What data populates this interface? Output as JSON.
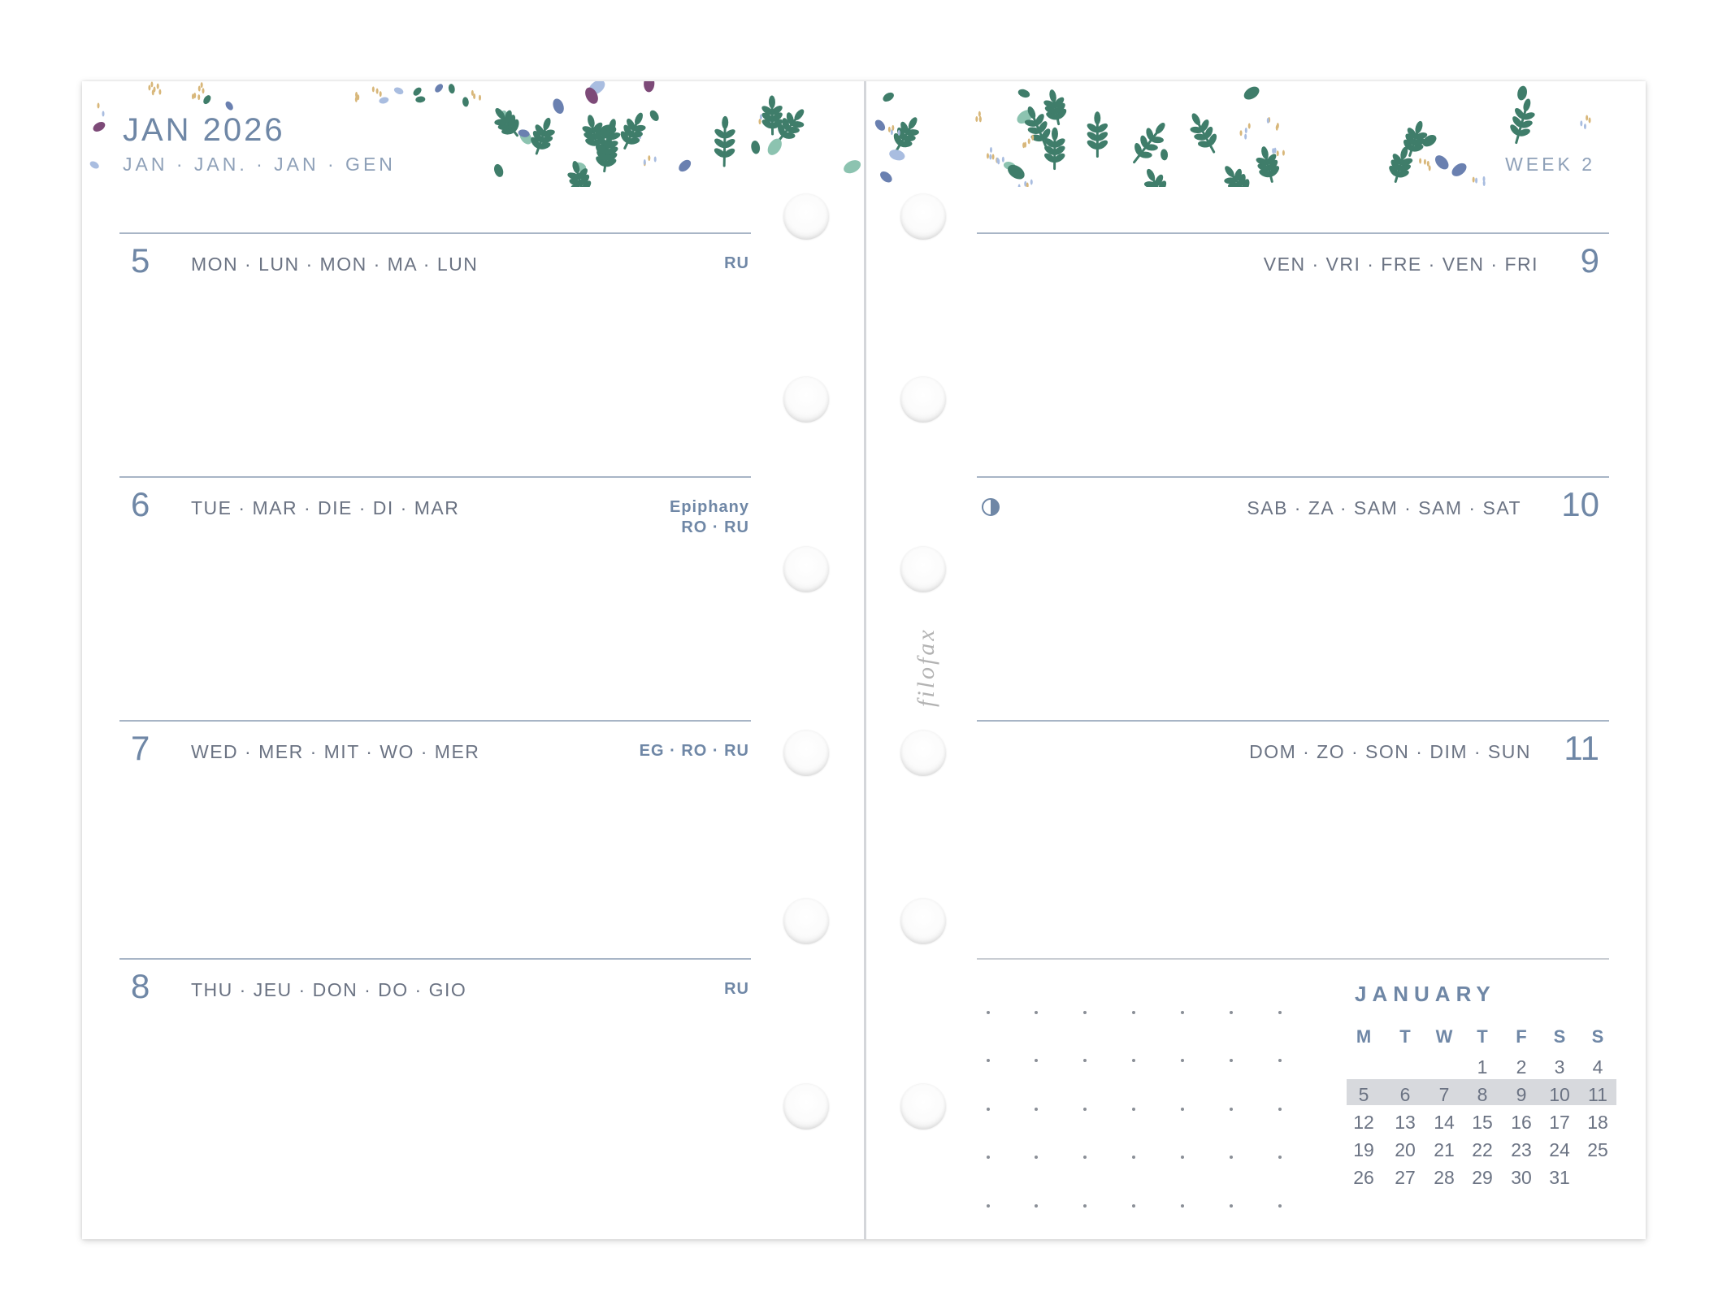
{
  "page": {
    "month_title": "JAN 2026",
    "month_sub": "JAN · JAN. · JAN · GEN",
    "week_label": "WEEK 2",
    "brand": "filofax"
  },
  "days": {
    "d5": {
      "num": "5",
      "names": "MON · LUN · MON · MA · LUN",
      "holiday1": "RU",
      "holiday2": ""
    },
    "d6": {
      "num": "6",
      "names": "TUE · MAR · DIE · DI · MAR",
      "holiday1": "Epiphany",
      "holiday2": "RO · RU"
    },
    "d7": {
      "num": "7",
      "names": "WED · MER · MIT · WO · MER",
      "holiday1": "EG · RO · RU",
      "holiday2": ""
    },
    "d8": {
      "num": "8",
      "names": "THU · JEU · DON · DO · GIO",
      "holiday1": "RU",
      "holiday2": ""
    },
    "d9": {
      "num": "9",
      "names": "VEN · VRI · FRE · VEN · FRI"
    },
    "d10": {
      "num": "10",
      "names": "SAB · ZA · SAM · SAM · SAT",
      "moon_icon": "first-quarter-moon-icon"
    },
    "d11": {
      "num": "11",
      "names": "DOM · ZO · SON · DIM · SUN"
    }
  },
  "mini_calendar": {
    "title": "JANUARY",
    "weekdays": [
      "M",
      "T",
      "W",
      "T",
      "F",
      "S",
      "S"
    ],
    "weeks": [
      [
        "",
        "",
        "",
        "1",
        "2",
        "3",
        "4"
      ],
      [
        "5",
        "6",
        "7",
        "8",
        "9",
        "10",
        "11"
      ],
      [
        "12",
        "13",
        "14",
        "15",
        "16",
        "17",
        "18"
      ],
      [
        "19",
        "20",
        "21",
        "22",
        "23",
        "24",
        "25"
      ],
      [
        "26",
        "27",
        "28",
        "29",
        "30",
        "31",
        ""
      ]
    ],
    "highlighted_week": 2
  },
  "colors": {
    "accent": "#6f87a6",
    "text": "#6b7383",
    "rule": "#a8b5c6",
    "leaf_green": "#3f7d6a",
    "leaf_mint": "#8cc3b0",
    "leaf_blue": "#6a80b0",
    "leaf_light_blue": "#a9bde0",
    "leaf_purple": "#7d4a78",
    "speckle_gold": "#d8b77a"
  }
}
